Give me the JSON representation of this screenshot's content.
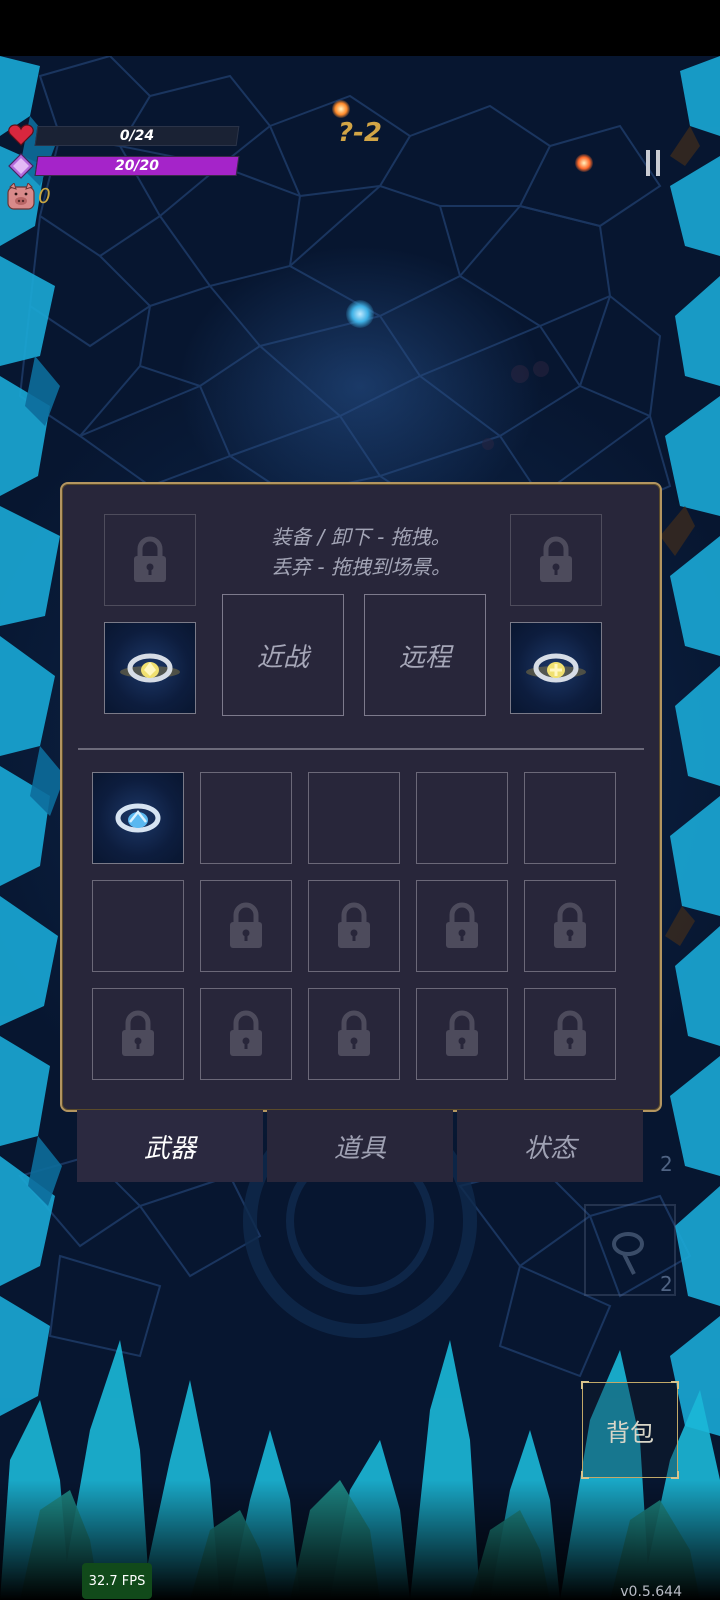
{
  "hud": {
    "hp_text": "0/24",
    "hp_fraction": 0,
    "mp_text": "20/20",
    "mp_fraction": 1,
    "gold": "0",
    "stage": "?-2",
    "colors": {
      "hp": "#c0334a",
      "mp": "#a524c9",
      "gold": "#c8a640",
      "stage": "#d2a546"
    }
  },
  "panel": {
    "hint_line1": "装备 / 卸下 - 拖拽。",
    "hint_line2": "丢弃 - 拖拽到场景。",
    "melee_label": "近战",
    "ranged_label": "远程",
    "icons": {
      "lock": "lock-icon",
      "ring_gold": "gold-ring-icon",
      "ring_blue": "blue-ring-icon"
    }
  },
  "tabs": [
    {
      "label": "武器",
      "active": true
    },
    {
      "label": "道具",
      "active": false
    },
    {
      "label": "状态",
      "active": false
    }
  ],
  "bag_label": "背包",
  "ghost_counts": [
    "2",
    "2"
  ],
  "fps": "32.7 FPS",
  "version": "v0.5.644"
}
